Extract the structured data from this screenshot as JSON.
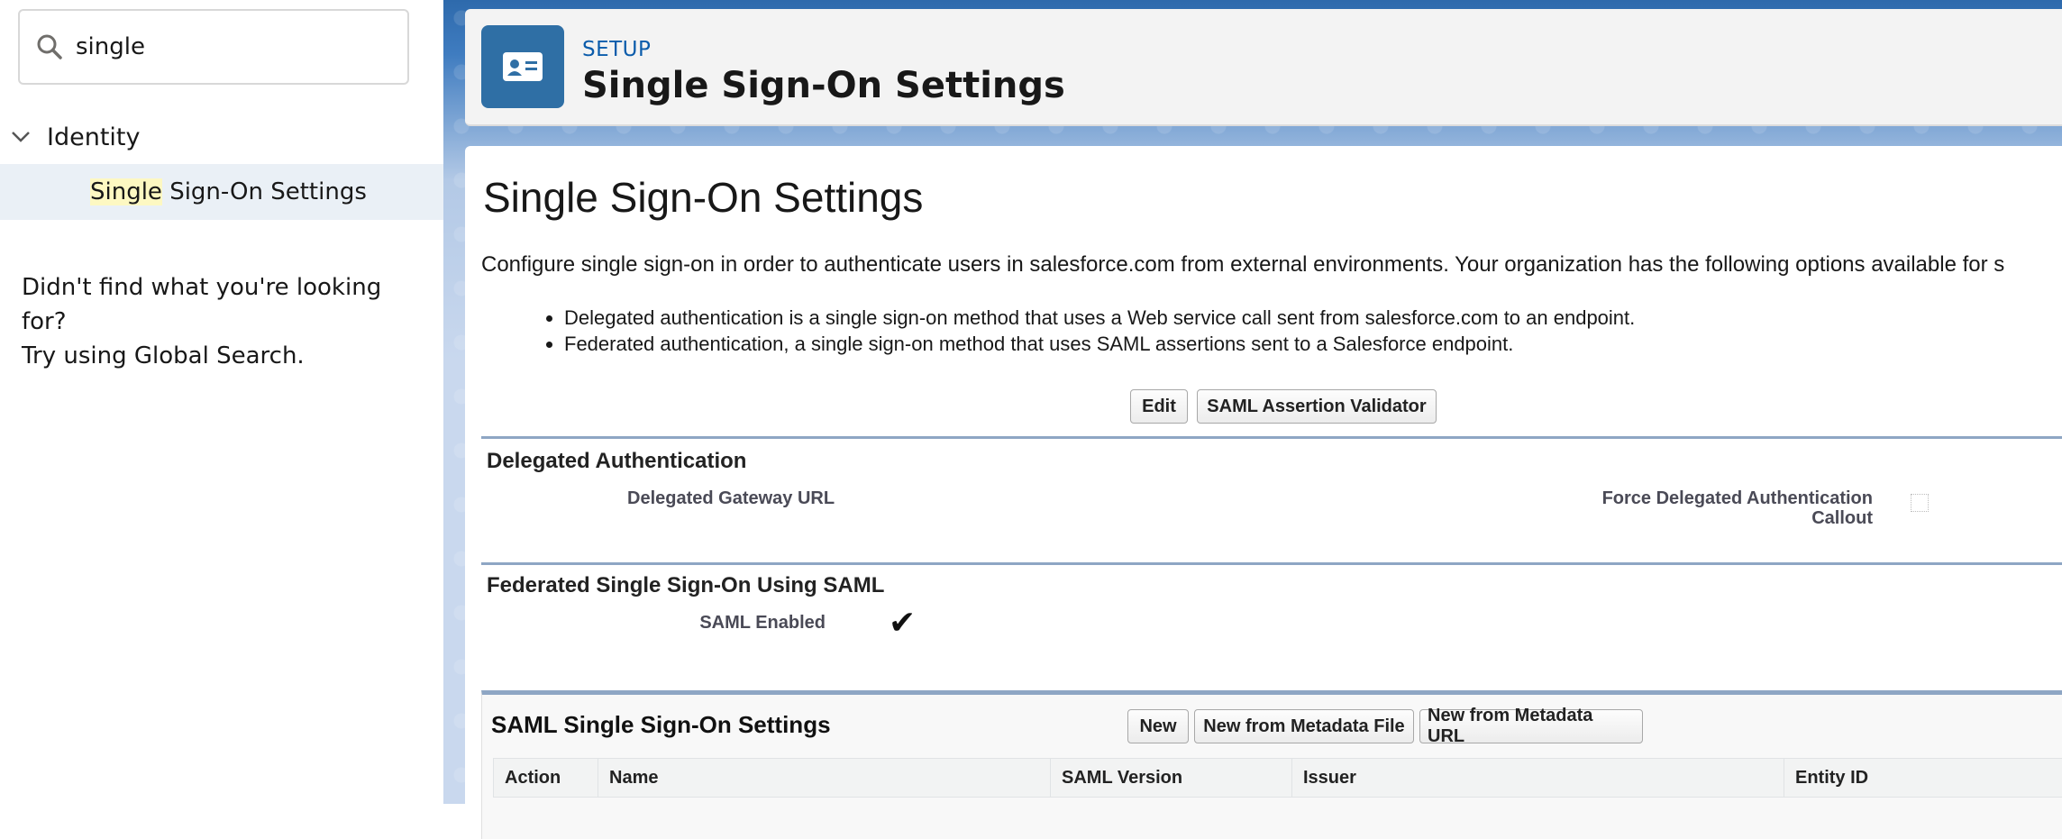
{
  "sidebar": {
    "search": {
      "value": "single"
    },
    "tree": {
      "parent_label": "Identity",
      "child_highlight": "Single",
      "child_rest": " Sign-On Settings"
    },
    "help_line1": "Didn't find what you're looking for?",
    "help_line2": "Try using Global Search."
  },
  "header": {
    "eyebrow": "SETUP",
    "title": "Single Sign-On Settings"
  },
  "main": {
    "title": "Single Sign-On Settings",
    "description": "Configure single sign-on in order to authenticate users in salesforce.com from external environments. Your organization has the following options available for s",
    "bullets": [
      "Delegated authentication is a single sign-on method that uses a Web service call sent from salesforce.com to an endpoint.",
      "Federated authentication, a single sign-on method that uses SAML assertions sent to a Salesforce endpoint."
    ],
    "buttons": {
      "edit": "Edit",
      "saml_validator": "SAML Assertion Validator"
    },
    "delegated": {
      "title": "Delegated Authentication",
      "gateway_url_label": "Delegated Gateway URL",
      "force_callout_label_line1": "Force Delegated Authentication",
      "force_callout_label_line2": "Callout",
      "force_callout_checked": false
    },
    "federated": {
      "title": "Federated Single Sign-On Using SAML",
      "saml_enabled_label": "SAML Enabled",
      "saml_enabled_checked": true
    },
    "saml_settings": {
      "title": "SAML Single Sign-On Settings",
      "buttons": {
        "new": "New",
        "new_from_file": "New from Metadata File",
        "new_from_url": "New from Metadata URL"
      },
      "columns": [
        "Action",
        "Name",
        "SAML Version",
        "Issuer",
        "Entity ID"
      ]
    }
  },
  "colors": {
    "accent": "#0b5cab",
    "header_icon_bg": "#2f6fa5",
    "selected_row_bg": "#eaf0f6",
    "highlight": "#fdf8c2",
    "section_rule": "#8ea6c4"
  }
}
